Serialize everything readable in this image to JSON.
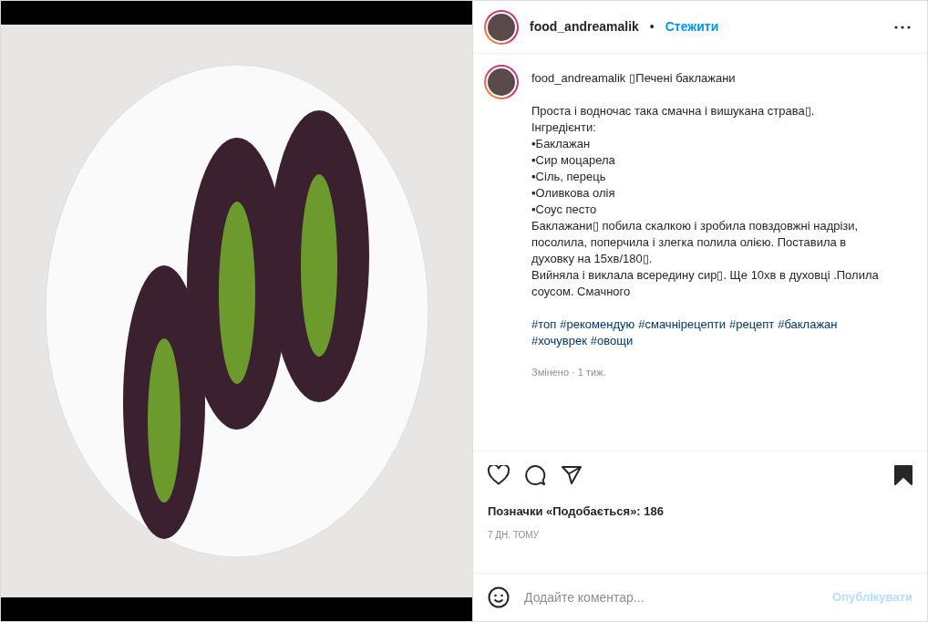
{
  "header": {
    "username": "food_andreamalik",
    "separator": "•",
    "follow": "Стежити"
  },
  "caption": {
    "username": "food_andreamalik",
    "title": "▯Печені баклажани",
    "lines": [
      "Проста і водночас така смачна і вишукана страва▯.",
      "Інгредієнти:",
      "▪Баклажан",
      "▪Сир моцарела",
      "▪Сіль, перець",
      "▪Оливкова олія",
      "▪Соус песто",
      "Баклажани▯ побила скалкою і зробила повздовжні надрізи, посолила, поперчила і злегка полила олією. Поставила в духовку на 15хв/180▯.",
      "Вийняла і виклала всередину сир▯. Ще 10хв в духовці .Полила соусом. Смачного"
    ],
    "hashtags": [
      "#топ",
      "#рекомендую",
      "#смачнірецепти",
      "#рецепт",
      "#баклажан",
      "#хочуврек",
      "#овощи"
    ],
    "edited": "Змінено · 1 тиж."
  },
  "actions": {
    "liked": false,
    "saved": true
  },
  "likes": "Позначки «Подобається»: 186",
  "time": "7 ДН. ТОМУ",
  "comment": {
    "placeholder": "Додайте коментар...",
    "publish": "Опублікувати",
    "disabled": true
  }
}
